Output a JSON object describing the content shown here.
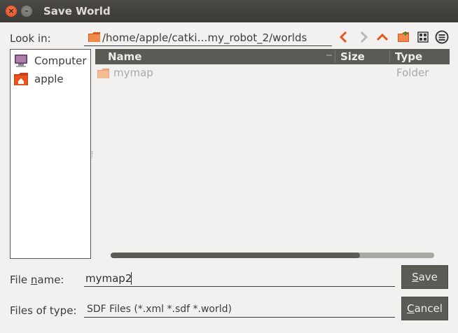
{
  "window": {
    "title": "Save World"
  },
  "look_in": {
    "label": "Look in:",
    "path": "/home/apple/catki…my_robot_2/worlds"
  },
  "sidebar": {
    "items": [
      {
        "label": "Computer",
        "icon": "computer-icon"
      },
      {
        "label": "apple",
        "icon": "home-folder-icon"
      }
    ]
  },
  "file_list": {
    "columns": [
      "Name",
      "Size",
      "Type"
    ],
    "rows": [
      {
        "name": "mymap",
        "size": "",
        "type": "Folder",
        "icon": "folder-icon"
      }
    ]
  },
  "file_name": {
    "label_pre": "File ",
    "label_mnemonic": "n",
    "label_post": "ame:",
    "value": "mymap2"
  },
  "file_type": {
    "label": "Files of type:",
    "value": "SDF Files (*.xml *.sdf *.world)"
  },
  "buttons": {
    "save_mnemonic": "S",
    "save_rest": "ave",
    "cancel_mnemonic": "C",
    "cancel_rest": "ancel"
  },
  "colors": {
    "titlebar": "#3c3b37",
    "accent_orange": "#e95420",
    "header_bg": "#5b5a55",
    "button_bg": "#5b5a55"
  }
}
